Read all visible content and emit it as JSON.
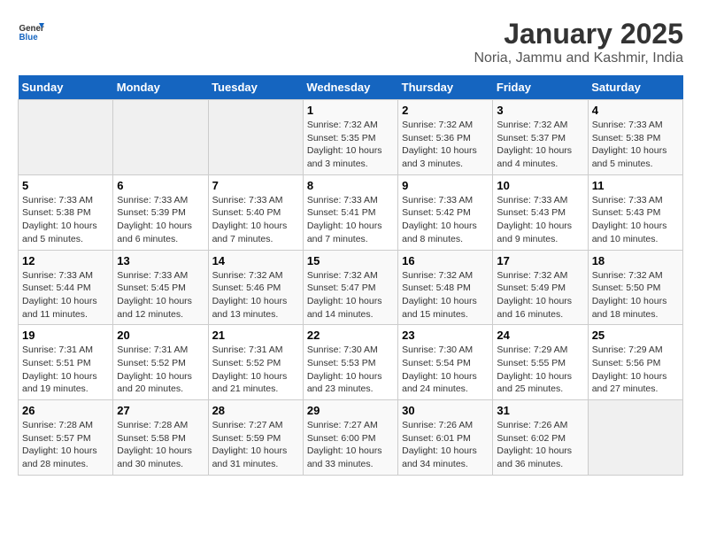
{
  "logo": {
    "text_general": "General",
    "text_blue": "Blue"
  },
  "header": {
    "title": "January 2025",
    "subtitle": "Noria, Jammu and Kashmir, India"
  },
  "weekdays": [
    "Sunday",
    "Monday",
    "Tuesday",
    "Wednesday",
    "Thursday",
    "Friday",
    "Saturday"
  ],
  "weeks": [
    [
      {
        "day": "",
        "info": ""
      },
      {
        "day": "",
        "info": ""
      },
      {
        "day": "",
        "info": ""
      },
      {
        "day": "1",
        "info": "Sunrise: 7:32 AM\nSunset: 5:35 PM\nDaylight: 10 hours\nand 3 minutes."
      },
      {
        "day": "2",
        "info": "Sunrise: 7:32 AM\nSunset: 5:36 PM\nDaylight: 10 hours\nand 3 minutes."
      },
      {
        "day": "3",
        "info": "Sunrise: 7:32 AM\nSunset: 5:37 PM\nDaylight: 10 hours\nand 4 minutes."
      },
      {
        "day": "4",
        "info": "Sunrise: 7:33 AM\nSunset: 5:38 PM\nDaylight: 10 hours\nand 5 minutes."
      }
    ],
    [
      {
        "day": "5",
        "info": "Sunrise: 7:33 AM\nSunset: 5:38 PM\nDaylight: 10 hours\nand 5 minutes."
      },
      {
        "day": "6",
        "info": "Sunrise: 7:33 AM\nSunset: 5:39 PM\nDaylight: 10 hours\nand 6 minutes."
      },
      {
        "day": "7",
        "info": "Sunrise: 7:33 AM\nSunset: 5:40 PM\nDaylight: 10 hours\nand 7 minutes."
      },
      {
        "day": "8",
        "info": "Sunrise: 7:33 AM\nSunset: 5:41 PM\nDaylight: 10 hours\nand 7 minutes."
      },
      {
        "day": "9",
        "info": "Sunrise: 7:33 AM\nSunset: 5:42 PM\nDaylight: 10 hours\nand 8 minutes."
      },
      {
        "day": "10",
        "info": "Sunrise: 7:33 AM\nSunset: 5:43 PM\nDaylight: 10 hours\nand 9 minutes."
      },
      {
        "day": "11",
        "info": "Sunrise: 7:33 AM\nSunset: 5:43 PM\nDaylight: 10 hours\nand 10 minutes."
      }
    ],
    [
      {
        "day": "12",
        "info": "Sunrise: 7:33 AM\nSunset: 5:44 PM\nDaylight: 10 hours\nand 11 minutes."
      },
      {
        "day": "13",
        "info": "Sunrise: 7:33 AM\nSunset: 5:45 PM\nDaylight: 10 hours\nand 12 minutes."
      },
      {
        "day": "14",
        "info": "Sunrise: 7:32 AM\nSunset: 5:46 PM\nDaylight: 10 hours\nand 13 minutes."
      },
      {
        "day": "15",
        "info": "Sunrise: 7:32 AM\nSunset: 5:47 PM\nDaylight: 10 hours\nand 14 minutes."
      },
      {
        "day": "16",
        "info": "Sunrise: 7:32 AM\nSunset: 5:48 PM\nDaylight: 10 hours\nand 15 minutes."
      },
      {
        "day": "17",
        "info": "Sunrise: 7:32 AM\nSunset: 5:49 PM\nDaylight: 10 hours\nand 16 minutes."
      },
      {
        "day": "18",
        "info": "Sunrise: 7:32 AM\nSunset: 5:50 PM\nDaylight: 10 hours\nand 18 minutes."
      }
    ],
    [
      {
        "day": "19",
        "info": "Sunrise: 7:31 AM\nSunset: 5:51 PM\nDaylight: 10 hours\nand 19 minutes."
      },
      {
        "day": "20",
        "info": "Sunrise: 7:31 AM\nSunset: 5:52 PM\nDaylight: 10 hours\nand 20 minutes."
      },
      {
        "day": "21",
        "info": "Sunrise: 7:31 AM\nSunset: 5:52 PM\nDaylight: 10 hours\nand 21 minutes."
      },
      {
        "day": "22",
        "info": "Sunrise: 7:30 AM\nSunset: 5:53 PM\nDaylight: 10 hours\nand 23 minutes."
      },
      {
        "day": "23",
        "info": "Sunrise: 7:30 AM\nSunset: 5:54 PM\nDaylight: 10 hours\nand 24 minutes."
      },
      {
        "day": "24",
        "info": "Sunrise: 7:29 AM\nSunset: 5:55 PM\nDaylight: 10 hours\nand 25 minutes."
      },
      {
        "day": "25",
        "info": "Sunrise: 7:29 AM\nSunset: 5:56 PM\nDaylight: 10 hours\nand 27 minutes."
      }
    ],
    [
      {
        "day": "26",
        "info": "Sunrise: 7:28 AM\nSunset: 5:57 PM\nDaylight: 10 hours\nand 28 minutes."
      },
      {
        "day": "27",
        "info": "Sunrise: 7:28 AM\nSunset: 5:58 PM\nDaylight: 10 hours\nand 30 minutes."
      },
      {
        "day": "28",
        "info": "Sunrise: 7:27 AM\nSunset: 5:59 PM\nDaylight: 10 hours\nand 31 minutes."
      },
      {
        "day": "29",
        "info": "Sunrise: 7:27 AM\nSunset: 6:00 PM\nDaylight: 10 hours\nand 33 minutes."
      },
      {
        "day": "30",
        "info": "Sunrise: 7:26 AM\nSunset: 6:01 PM\nDaylight: 10 hours\nand 34 minutes."
      },
      {
        "day": "31",
        "info": "Sunrise: 7:26 AM\nSunset: 6:02 PM\nDaylight: 10 hours\nand 36 minutes."
      },
      {
        "day": "",
        "info": ""
      }
    ]
  ]
}
